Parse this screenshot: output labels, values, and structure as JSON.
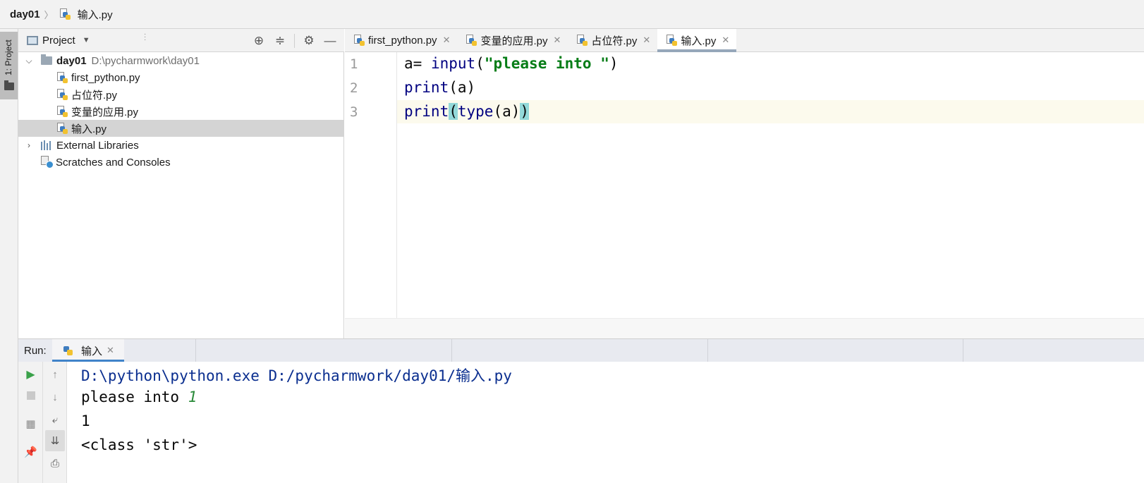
{
  "breadcrumb": {
    "project": "day01",
    "file": "输入.py"
  },
  "sidebar_strip": {
    "project_tab": "1: Project"
  },
  "project_panel": {
    "title": "Project",
    "tree": {
      "root_name": "day01",
      "root_path": "D:\\pycharmwork\\day01",
      "files": [
        "first_python.py",
        "占位符.py",
        "变量的应用.py",
        "输入.py"
      ],
      "selected": "输入.py",
      "external_libraries": "External Libraries",
      "scratches": "Scratches and Consoles"
    }
  },
  "editor": {
    "tabs": [
      {
        "label": "first_python.py",
        "active": false
      },
      {
        "label": "变量的应用.py",
        "active": false
      },
      {
        "label": "占位符.py",
        "active": false
      },
      {
        "label": "输入.py",
        "active": true
      }
    ],
    "line_numbers": [
      "1",
      "2",
      "3"
    ],
    "code": {
      "l1_var": "a",
      "l1_eq": "=",
      "l1_func": "input",
      "l1_open": "(",
      "l1_str": "\"please into \"",
      "l1_close": ")",
      "l2_func": "print",
      "l2_args": "(a)",
      "l3_func": "print",
      "l3_open": "(",
      "l3_inner_func": "type",
      "l3_inner_args": "(a)",
      "l3_close": ")"
    }
  },
  "run_panel": {
    "label": "Run:",
    "tab_label": "输入",
    "console": {
      "command": "D:\\python\\python.exe D:/pycharmwork/day01/输入.py",
      "prompt": "please into ",
      "user_input": "1",
      "output_1": "1",
      "output_2": "<class 'str'>"
    }
  },
  "colors": {
    "keyword": "#000080",
    "string": "#067d17",
    "brace_match": "#93d9d9",
    "current_line": "#fcfaed",
    "run_play": "#3aa14a",
    "run_tab_underline": "#4083c9"
  }
}
